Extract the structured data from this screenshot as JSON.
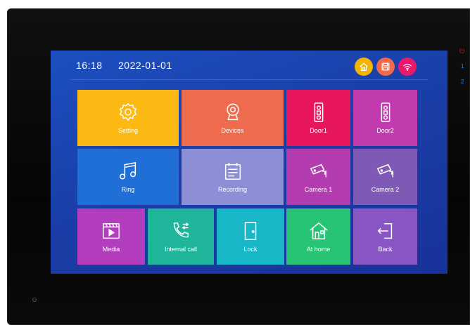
{
  "status": {
    "time": "16:18",
    "date": "2022-01-01",
    "icons": [
      {
        "name": "home-mode-icon",
        "color": "#f5b400"
      },
      {
        "name": "save-icon",
        "color": "#f06a4a"
      },
      {
        "name": "wifi-icon",
        "color": "#e8196a"
      }
    ]
  },
  "tiles": {
    "setting": {
      "label": "Setting",
      "color": "#fdb913",
      "icon": "gear-icon"
    },
    "devices": {
      "label": "Devices",
      "color": "#ef6b4d",
      "icon": "webcam-icon"
    },
    "door1": {
      "label": "Door1",
      "color": "#e8175d",
      "icon": "doorbell-icon"
    },
    "door2": {
      "label": "Door2",
      "color": "#c13aae",
      "icon": "doorbell-icon"
    },
    "ring": {
      "label": "Ring",
      "color": "#1f6fd6",
      "icon": "music-note-icon"
    },
    "recording": {
      "label": "Recording",
      "color": "#8d8fd6",
      "icon": "calendar-icon"
    },
    "camera1": {
      "label": "Camera 1",
      "color": "#b33cb0",
      "icon": "cctv-camera-icon"
    },
    "camera2": {
      "label": "Camera 2",
      "color": "#7e5ab6",
      "icon": "cctv-camera-icon"
    },
    "media": {
      "label": "Media",
      "color": "#b23dbd",
      "icon": "media-player-icon"
    },
    "internal_call": {
      "label": "Internal call",
      "color": "#1fb59b",
      "icon": "phone-call-icon"
    },
    "lock": {
      "label": "Lock",
      "color": "#17b7c8",
      "icon": "door-icon"
    },
    "at_home": {
      "label": "At home",
      "color": "#27c475",
      "icon": "house-icon"
    },
    "back": {
      "label": "Back",
      "color": "#8a56c4",
      "icon": "back-arrow-icon"
    }
  },
  "side_indicators": {
    "power": "⏻",
    "one": "1",
    "two": "2"
  }
}
